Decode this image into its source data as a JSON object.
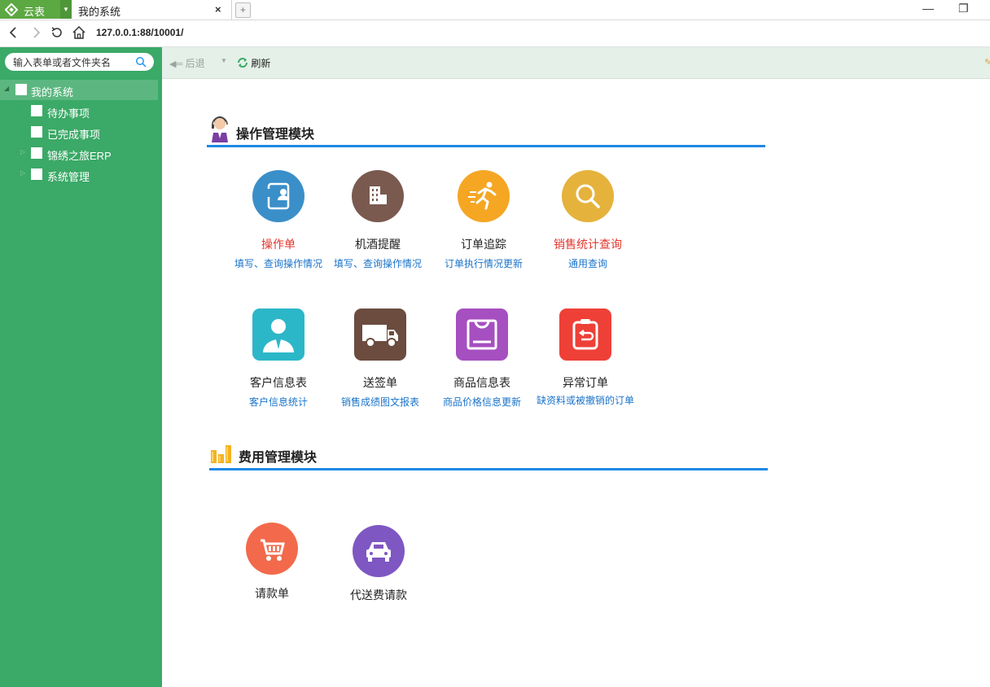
{
  "browser": {
    "brand_label": "云表",
    "tab_title": "我的系统",
    "tab_close": "×",
    "new_tab": "+",
    "minimize": "—",
    "restore": "❐",
    "url": "127.0.0.1:88/10001/"
  },
  "sidebar": {
    "search_placeholder": "输入表单或者文件夹名",
    "root": "我的系统",
    "items": [
      {
        "label": "待办事项"
      },
      {
        "label": "已完成事项"
      },
      {
        "label": "锦绣之旅ERP"
      },
      {
        "label": "系统管理"
      }
    ]
  },
  "toolbar": {
    "back_label": "后退",
    "refresh_label": "刷新"
  },
  "sections": [
    {
      "title": "操作管理模块",
      "tiles": [
        {
          "name": "操作单",
          "desc": "填写、查询操作情况",
          "color": "#3b8fc9",
          "name_color": "red"
        },
        {
          "name": "机酒提醒",
          "desc": "填写、查询操作情况",
          "color": "#7a5a4f",
          "name_color": "black"
        },
        {
          "name": "订单追踪",
          "desc": "订单执行情况更新",
          "color": "#f5a623",
          "name_color": "black"
        },
        {
          "name": "销售统计查询",
          "desc": "通用查询",
          "color": "#e5b23c",
          "name_color": "red"
        },
        {
          "name": "客户信息表",
          "desc": "客户信息统计",
          "color": "#2cb7c9",
          "name_color": "black"
        },
        {
          "name": "送签单",
          "desc": "销售成绩图文报表",
          "color": "#6b4c3f",
          "name_color": "black"
        },
        {
          "name": "商品信息表",
          "desc": "商品价格信息更新",
          "color": "#a64fc0",
          "name_color": "black"
        },
        {
          "name": "异常订单",
          "desc": "缺资料或被撤销的订单",
          "color": "#ee4037",
          "name_color": "black"
        }
      ]
    },
    {
      "title": "费用管理模块",
      "tiles": [
        {
          "name": "请款单",
          "color": "#f26a4b"
        },
        {
          "name": "代送费请款",
          "color": "#7e57c2"
        }
      ]
    }
  ]
}
